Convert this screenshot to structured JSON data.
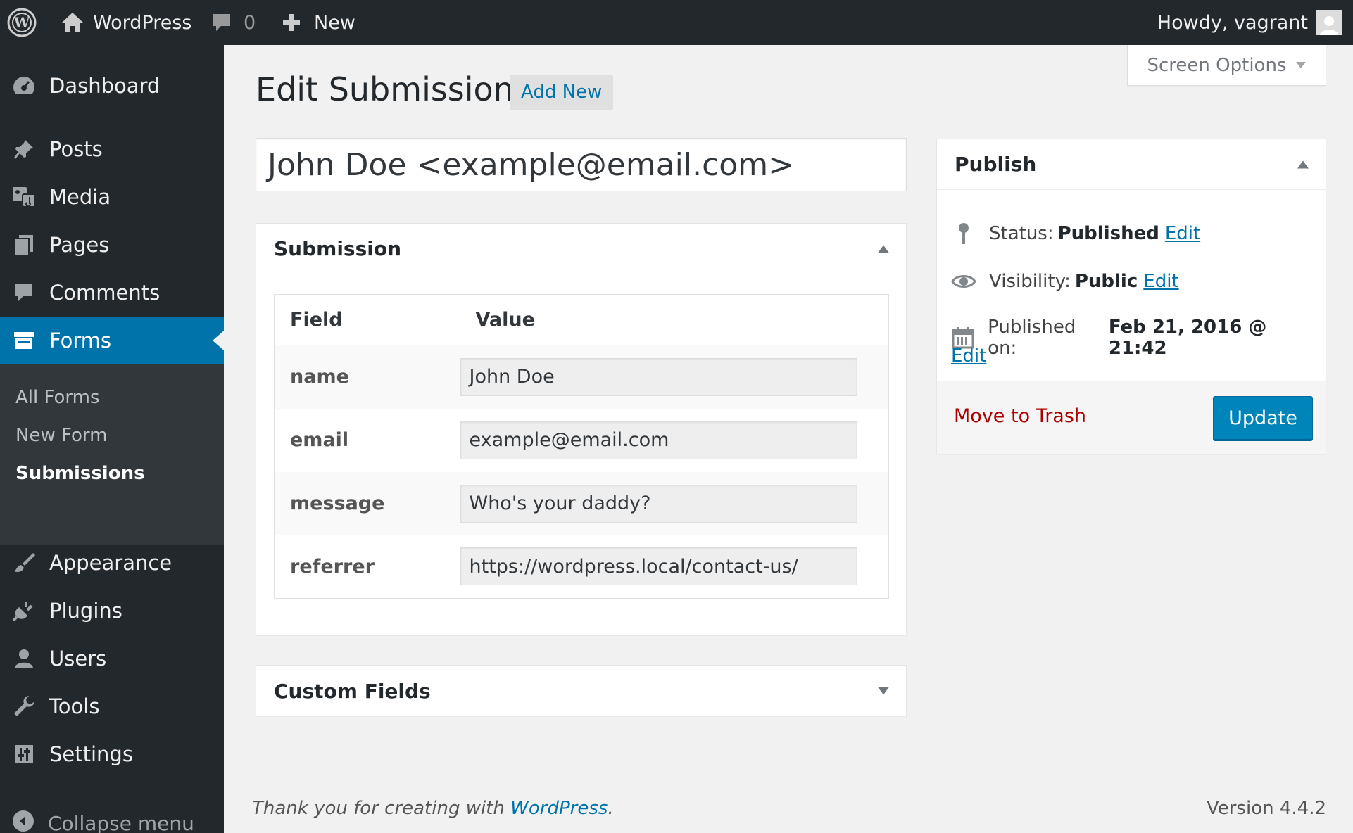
{
  "adminbar": {
    "site_name": "WordPress",
    "comment_count": "0",
    "new_label": "New",
    "howdy": "Howdy, vagrant"
  },
  "sidebar": {
    "items": [
      {
        "label": "Dashboard",
        "icon": "dashboard-icon"
      },
      {
        "label": "Posts",
        "icon": "pin-icon"
      },
      {
        "label": "Media",
        "icon": "media-icon"
      },
      {
        "label": "Pages",
        "icon": "pages-icon"
      },
      {
        "label": "Comments",
        "icon": "comment-icon"
      },
      {
        "label": "Forms",
        "icon": "forms-icon",
        "current": true
      },
      {
        "label": "Appearance",
        "icon": "brush-icon"
      },
      {
        "label": "Plugins",
        "icon": "plug-icon"
      },
      {
        "label": "Users",
        "icon": "user-icon"
      },
      {
        "label": "Tools",
        "icon": "wrench-icon"
      },
      {
        "label": "Settings",
        "icon": "settings-icon"
      }
    ],
    "submenu": [
      {
        "label": "All Forms"
      },
      {
        "label": "New Form"
      },
      {
        "label": "Submissions",
        "current": true
      }
    ],
    "collapse_label": "Collapse menu"
  },
  "screen_options": "Screen Options",
  "page": {
    "title": "Edit Submission",
    "add_new": "Add New",
    "post_title": "John Doe <example@email.com>"
  },
  "submission": {
    "heading": "Submission",
    "columns": [
      "Field",
      "Value"
    ],
    "rows": [
      {
        "field": "name",
        "value": "John Doe"
      },
      {
        "field": "email",
        "value": "example@email.com"
      },
      {
        "field": "message",
        "value": "Who's your daddy?"
      },
      {
        "field": "referrer",
        "value": "https://wordpress.local/contact-us/"
      }
    ]
  },
  "custom_fields": {
    "heading": "Custom Fields"
  },
  "publish": {
    "heading": "Publish",
    "status_label": "Status:",
    "status_value": "Published",
    "visibility_label": "Visibility:",
    "visibility_value": "Public",
    "published_label": "Published on:",
    "published_value": "Feb 21, 2016 @ 21:42",
    "edit_link": "Edit",
    "trash": "Move to Trash",
    "update": "Update"
  },
  "footer": {
    "thanks": "Thank you for creating with",
    "wp_link": "WordPress",
    "period": ".",
    "version": "Version 4.4.2"
  },
  "colors": {
    "admin_bar": "#23282d",
    "accent": "#0073aa",
    "button": "#0085ba",
    "trash": "#aa0000"
  }
}
